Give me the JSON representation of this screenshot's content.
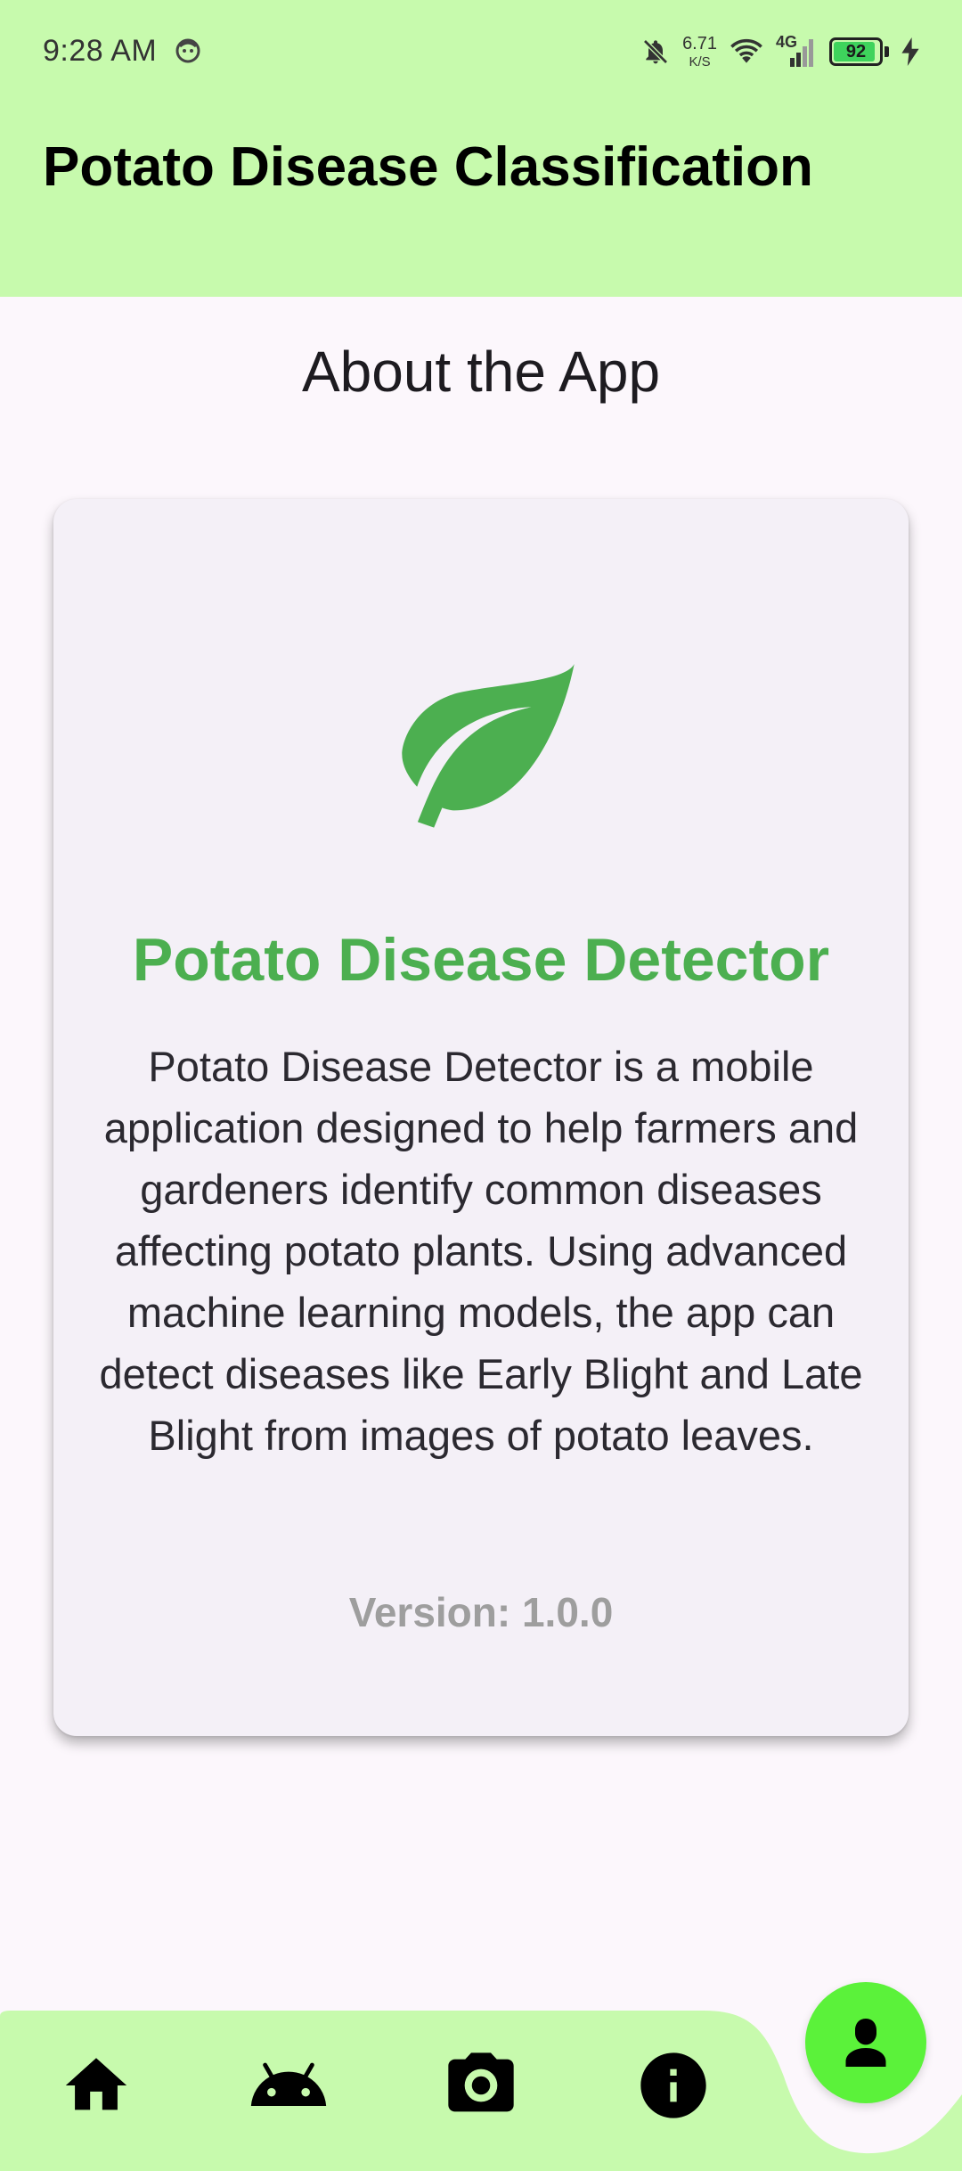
{
  "status_bar": {
    "time": "9:28 AM",
    "net_speed_value": "6.71",
    "net_speed_unit": "K/S",
    "network_type": "4G",
    "battery_level": "92"
  },
  "app_bar": {
    "title": "Potato Disease Classification",
    "background_color": "#C7FAAD"
  },
  "page": {
    "heading": "About the App"
  },
  "about_card": {
    "icon": "leaf-icon",
    "title": "Potato Disease Detector",
    "description": "Potato Disease Detector is a mobile application designed to help farmers and gardeners identify common diseases affecting potato plants. Using advanced machine learning models, the app can detect diseases like Early Blight and Late Blight from images of potato leaves.",
    "version": "Version: 1.0.0",
    "accent_color": "#4CAF50"
  },
  "bottom_nav": {
    "items": [
      {
        "icon": "home-icon"
      },
      {
        "icon": "android-icon"
      },
      {
        "icon": "camera-icon"
      },
      {
        "icon": "info-icon"
      }
    ],
    "fab_icon": "person-icon",
    "fab_color": "#5BF23A"
  }
}
